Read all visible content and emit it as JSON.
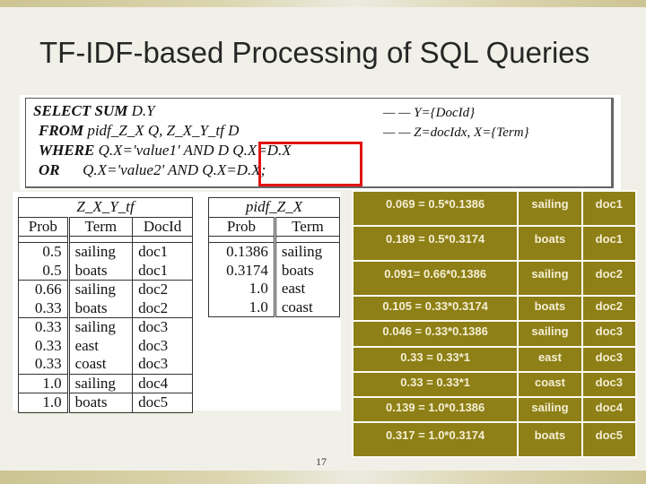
{
  "slide": {
    "title": "TF-IDF-based Processing of SQL Queries",
    "page_number": "17"
  },
  "sql": {
    "lines": [
      {
        "keyword": "SELECT SUM",
        "text": " D.Y"
      },
      {
        "keyword": "FROM",
        "text": " pidf_Z_X Q, Z_X_Y_tf D"
      },
      {
        "keyword": "WHERE",
        "text": " Q.X='value1' AND D Q.X=D.X"
      },
      {
        "keyword": "OR",
        "text": "      Q.X='value2' AND Q.X=D.X;"
      }
    ],
    "comments": [
      "— — Y={DocId}",
      "— — Z=docIdx, X={Term}"
    ],
    "highlight_color": "#e11414"
  },
  "z_x_y_tf": {
    "caption": "Z_X_Y_tf",
    "headers": [
      "Prob",
      "Term",
      "DocId"
    ],
    "groups": [
      [
        [
          "0.5",
          "sailing",
          "doc1"
        ],
        [
          "0.5",
          "boats",
          "doc1"
        ]
      ],
      [
        [
          "0.66",
          "sailing",
          "doc2"
        ],
        [
          "0.33",
          "boats",
          "doc2"
        ]
      ],
      [
        [
          "0.33",
          "sailing",
          "doc3"
        ],
        [
          "0.33",
          "east",
          "doc3"
        ],
        [
          "0.33",
          "coast",
          "doc3"
        ]
      ],
      [
        [
          "1.0",
          "sailing",
          "doc4"
        ]
      ],
      [
        [
          "1.0",
          "boats",
          "doc5"
        ]
      ]
    ]
  },
  "pidf_z_x": {
    "caption": "pidf_Z_X",
    "headers": [
      "Prob",
      "Term"
    ],
    "rows": [
      [
        "0.1386",
        "sailing"
      ],
      [
        "0.3174",
        "boats"
      ],
      [
        "1.0",
        "east"
      ],
      [
        "1.0",
        "coast"
      ]
    ]
  },
  "result": {
    "background": "#8e7f16",
    "rows": [
      [
        "0.069 = 0.5*0.1386",
        "sailing",
        "doc1"
      ],
      [
        "0.189 = 0.5*0.3174",
        "boats",
        "doc1"
      ],
      [
        "0.091= 0.66*0.1386",
        "sailing",
        "doc2"
      ],
      [
        "0.105 = 0.33*0.3174",
        "boats",
        "doc2"
      ],
      [
        "0.046 = 0.33*0.1386",
        "sailing",
        "doc3"
      ],
      [
        "0.33 = 0.33*1",
        "east",
        "doc3"
      ],
      [
        "0.33 = 0.33*1",
        "coast",
        "doc3"
      ],
      [
        "0.139 = 1.0*0.1386",
        "sailing",
        "doc4"
      ],
      [
        "0.317 = 1.0*0.3174",
        "boats",
        "doc5"
      ]
    ]
  }
}
